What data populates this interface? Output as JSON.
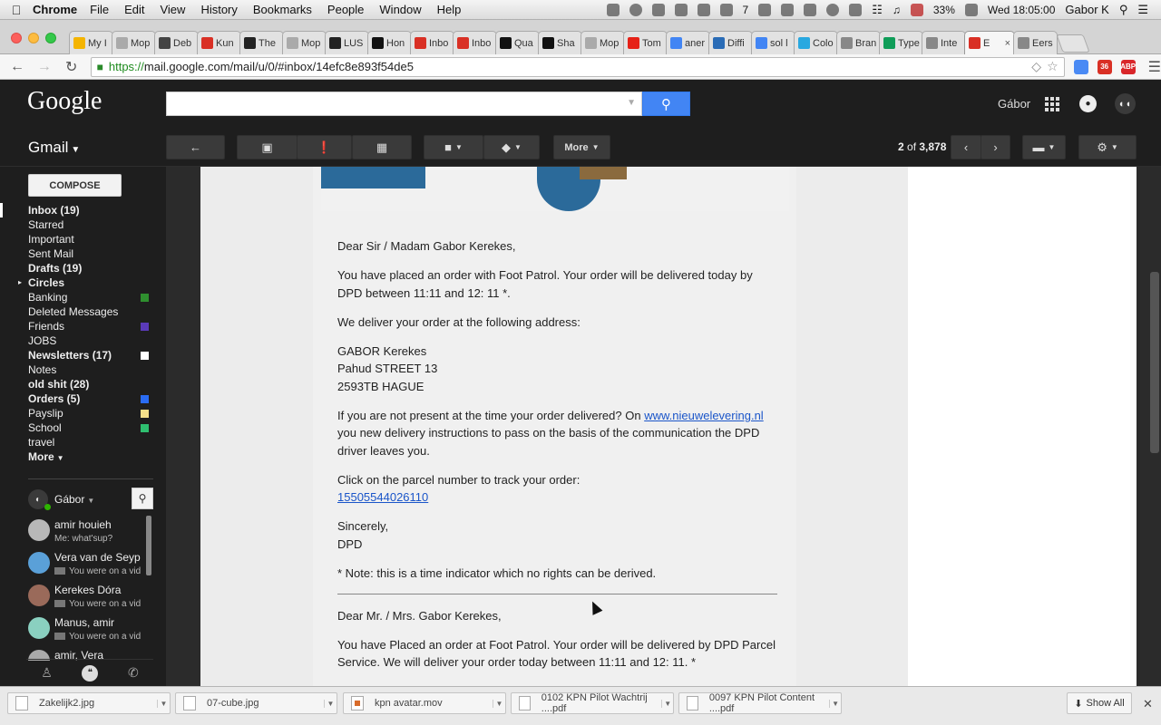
{
  "menubar": {
    "app": "Chrome",
    "menus": [
      "File",
      "Edit",
      "View",
      "History",
      "Bookmarks",
      "People",
      "Window",
      "Help"
    ],
    "tray_number": "7",
    "battery": "33%",
    "clock": "Wed 18:05:00",
    "user": "Gabor K"
  },
  "tabs": [
    {
      "label": "My I",
      "icon": "drive-icon",
      "color": "#f4b400"
    },
    {
      "label": "Mop",
      "icon": "doc-icon",
      "color": "#aaaaaa"
    },
    {
      "label": "Deb",
      "icon": "grid-icon",
      "color": "#444444"
    },
    {
      "label": "Kun",
      "icon": "gmail-icon",
      "color": "#d93025"
    },
    {
      "label": "The",
      "icon": "grid-icon",
      "color": "#222222"
    },
    {
      "label": "Mop",
      "icon": "doc-icon",
      "color": "#aaaaaa"
    },
    {
      "label": "LUS",
      "icon": "grid-icon",
      "color": "#222222"
    },
    {
      "label": "Hon",
      "icon": "medium-icon",
      "color": "#111111"
    },
    {
      "label": "Inbo",
      "icon": "gmail-icon",
      "color": "#d93025"
    },
    {
      "label": "Inbo",
      "icon": "gmail-icon",
      "color": "#d93025"
    },
    {
      "label": "Qua",
      "icon": "quip-icon",
      "color": "#111111"
    },
    {
      "label": "Sha",
      "icon": "quip-icon",
      "color": "#111111"
    },
    {
      "label": "Mop",
      "icon": "doc-icon",
      "color": "#aaaaaa"
    },
    {
      "label": "Tom",
      "icon": "youtube-icon",
      "color": "#e62117"
    },
    {
      "label": "aner",
      "icon": "google-icon",
      "color": "#4285f4"
    },
    {
      "label": "Diffi",
      "icon": "hb-icon",
      "color": "#2a6cb6"
    },
    {
      "label": "sol l",
      "icon": "google-icon",
      "color": "#4285f4"
    },
    {
      "label": "Colo",
      "icon": "trello-icon",
      "color": "#29a8e0"
    },
    {
      "label": "Bran",
      "icon": "folder-icon",
      "color": "#888888"
    },
    {
      "label": "Type",
      "icon": "sheets-icon",
      "color": "#0f9d58"
    },
    {
      "label": "Inte",
      "icon": "folder-icon",
      "color": "#888888"
    },
    {
      "label": "E",
      "icon": "gmail-icon",
      "color": "#d93025",
      "active": true
    },
    {
      "label": "Eers",
      "icon": "folder-icon",
      "color": "#888888"
    }
  ],
  "address": {
    "url_secure": "https://",
    "url_rest": "mail.google.com/mail/u/0/#inbox/14efc8e893f54de5"
  },
  "extensions": [
    {
      "icon": "translate-icon",
      "color": "#4a8af4",
      "text": ""
    },
    {
      "icon": "gmail-ext-icon",
      "color": "#d93025",
      "text": "36"
    },
    {
      "icon": "abp-icon",
      "color": "#d9262a",
      "text": "ABP"
    }
  ],
  "header": {
    "logo": "Google",
    "user_name": "Gábor",
    "avatar_text": "◐◖"
  },
  "gmail": {
    "brand": "Gmail",
    "more_label": "More",
    "pager_current": "2",
    "pager_of": " of ",
    "pager_total": "3,878"
  },
  "sidebar": {
    "compose": "COMPOSE",
    "labels": [
      {
        "text": "Inbox (19)",
        "bold": true,
        "active": true,
        "color": ""
      },
      {
        "text": "Starred",
        "bold": false,
        "color": ""
      },
      {
        "text": "Important",
        "bold": false,
        "color": ""
      },
      {
        "text": "Sent Mail",
        "bold": false,
        "color": ""
      },
      {
        "text": "Drafts (19)",
        "bold": true,
        "color": ""
      },
      {
        "text": "Circles",
        "bold": true,
        "expand": true,
        "color": ""
      },
      {
        "text": "Banking",
        "bold": false,
        "color": "#2f8f2f"
      },
      {
        "text": "Deleted Messages",
        "bold": false,
        "color": ""
      },
      {
        "text": "Friends",
        "bold": false,
        "color": "#5a3ab8"
      },
      {
        "text": "JOBS",
        "bold": false,
        "color": ""
      },
      {
        "text": "Newsletters (17)",
        "bold": true,
        "color": "#ffffff"
      },
      {
        "text": "Notes",
        "bold": false,
        "color": ""
      },
      {
        "text": "old shit (28)",
        "bold": true,
        "color": ""
      },
      {
        "text": "Orders (5)",
        "bold": true,
        "color": "#2a6cf4"
      },
      {
        "text": "Payslip",
        "bold": false,
        "color": "#f5e08a"
      },
      {
        "text": "School",
        "bold": false,
        "color": "#2fbf70"
      },
      {
        "text": "travel",
        "bold": false,
        "color": ""
      },
      {
        "text": "More",
        "bold": true,
        "caret": true,
        "color": ""
      }
    ]
  },
  "chat": {
    "me": "Gábor",
    "contacts": [
      {
        "name": "amir houieh",
        "status": "Me: what'sup?",
        "video": false,
        "avatar_color": "#b8b8b8"
      },
      {
        "name": "Vera van de Seyp",
        "status": "You were on a vid",
        "video": true,
        "avatar_color": "#5aa0d8"
      },
      {
        "name": "Kerekes Dóra",
        "status": "You were on a vid",
        "video": true,
        "avatar_color": "#9a6a5a"
      },
      {
        "name": "Manus, amir",
        "status": "You were on a vid",
        "video": true,
        "avatar_color": "#8ad0c0"
      },
      {
        "name": "amir, Vera",
        "status": "",
        "video": false,
        "avatar_color": "#aaaaaa"
      }
    ]
  },
  "email": {
    "p1": "Dear Sir / Madam Gabor Kerekes,",
    "p2": "You have placed an order with Foot Patrol. Your order will be delivered today by DPD between 11:11 and 12: 11 *.",
    "p3": "We deliver your order at the following address:",
    "addr1": "GABOR Kerekes",
    "addr2": "Pahud STREET 13",
    "addr3": "2593TB HAGUE",
    "p4_pre": "If you are not present at the time your order delivered? On ",
    "p4_link": "www.nieuwelevering.nl",
    "p4_post": " you new delivery instructions to pass on the basis of the communication the DPD driver leaves you.",
    "p5": "Click on the parcel number to track your order:",
    "tracking": "15505544026110",
    "sign1": "Sincerely,",
    "sign2": "DPD",
    "note": "* Note: this is a time indicator which no rights can be derived.",
    "p6": "Dear Mr. / Mrs. Gabor Kerekes,",
    "p7": "You have Placed an order at Foot Patrol. Your order will be delivered by DPD Parcel Service. We will deliver your order today between 11:11 and 12: 11. *"
  },
  "downloads": {
    "items": [
      "Zakelijk2.jpg",
      "07-cube.jpg",
      "kpn avatar.mov",
      "0102 KPN Pilot Wachtrij ....pdf",
      "0097 KPN Pilot Content ....pdf"
    ],
    "show_all": "Show All"
  }
}
